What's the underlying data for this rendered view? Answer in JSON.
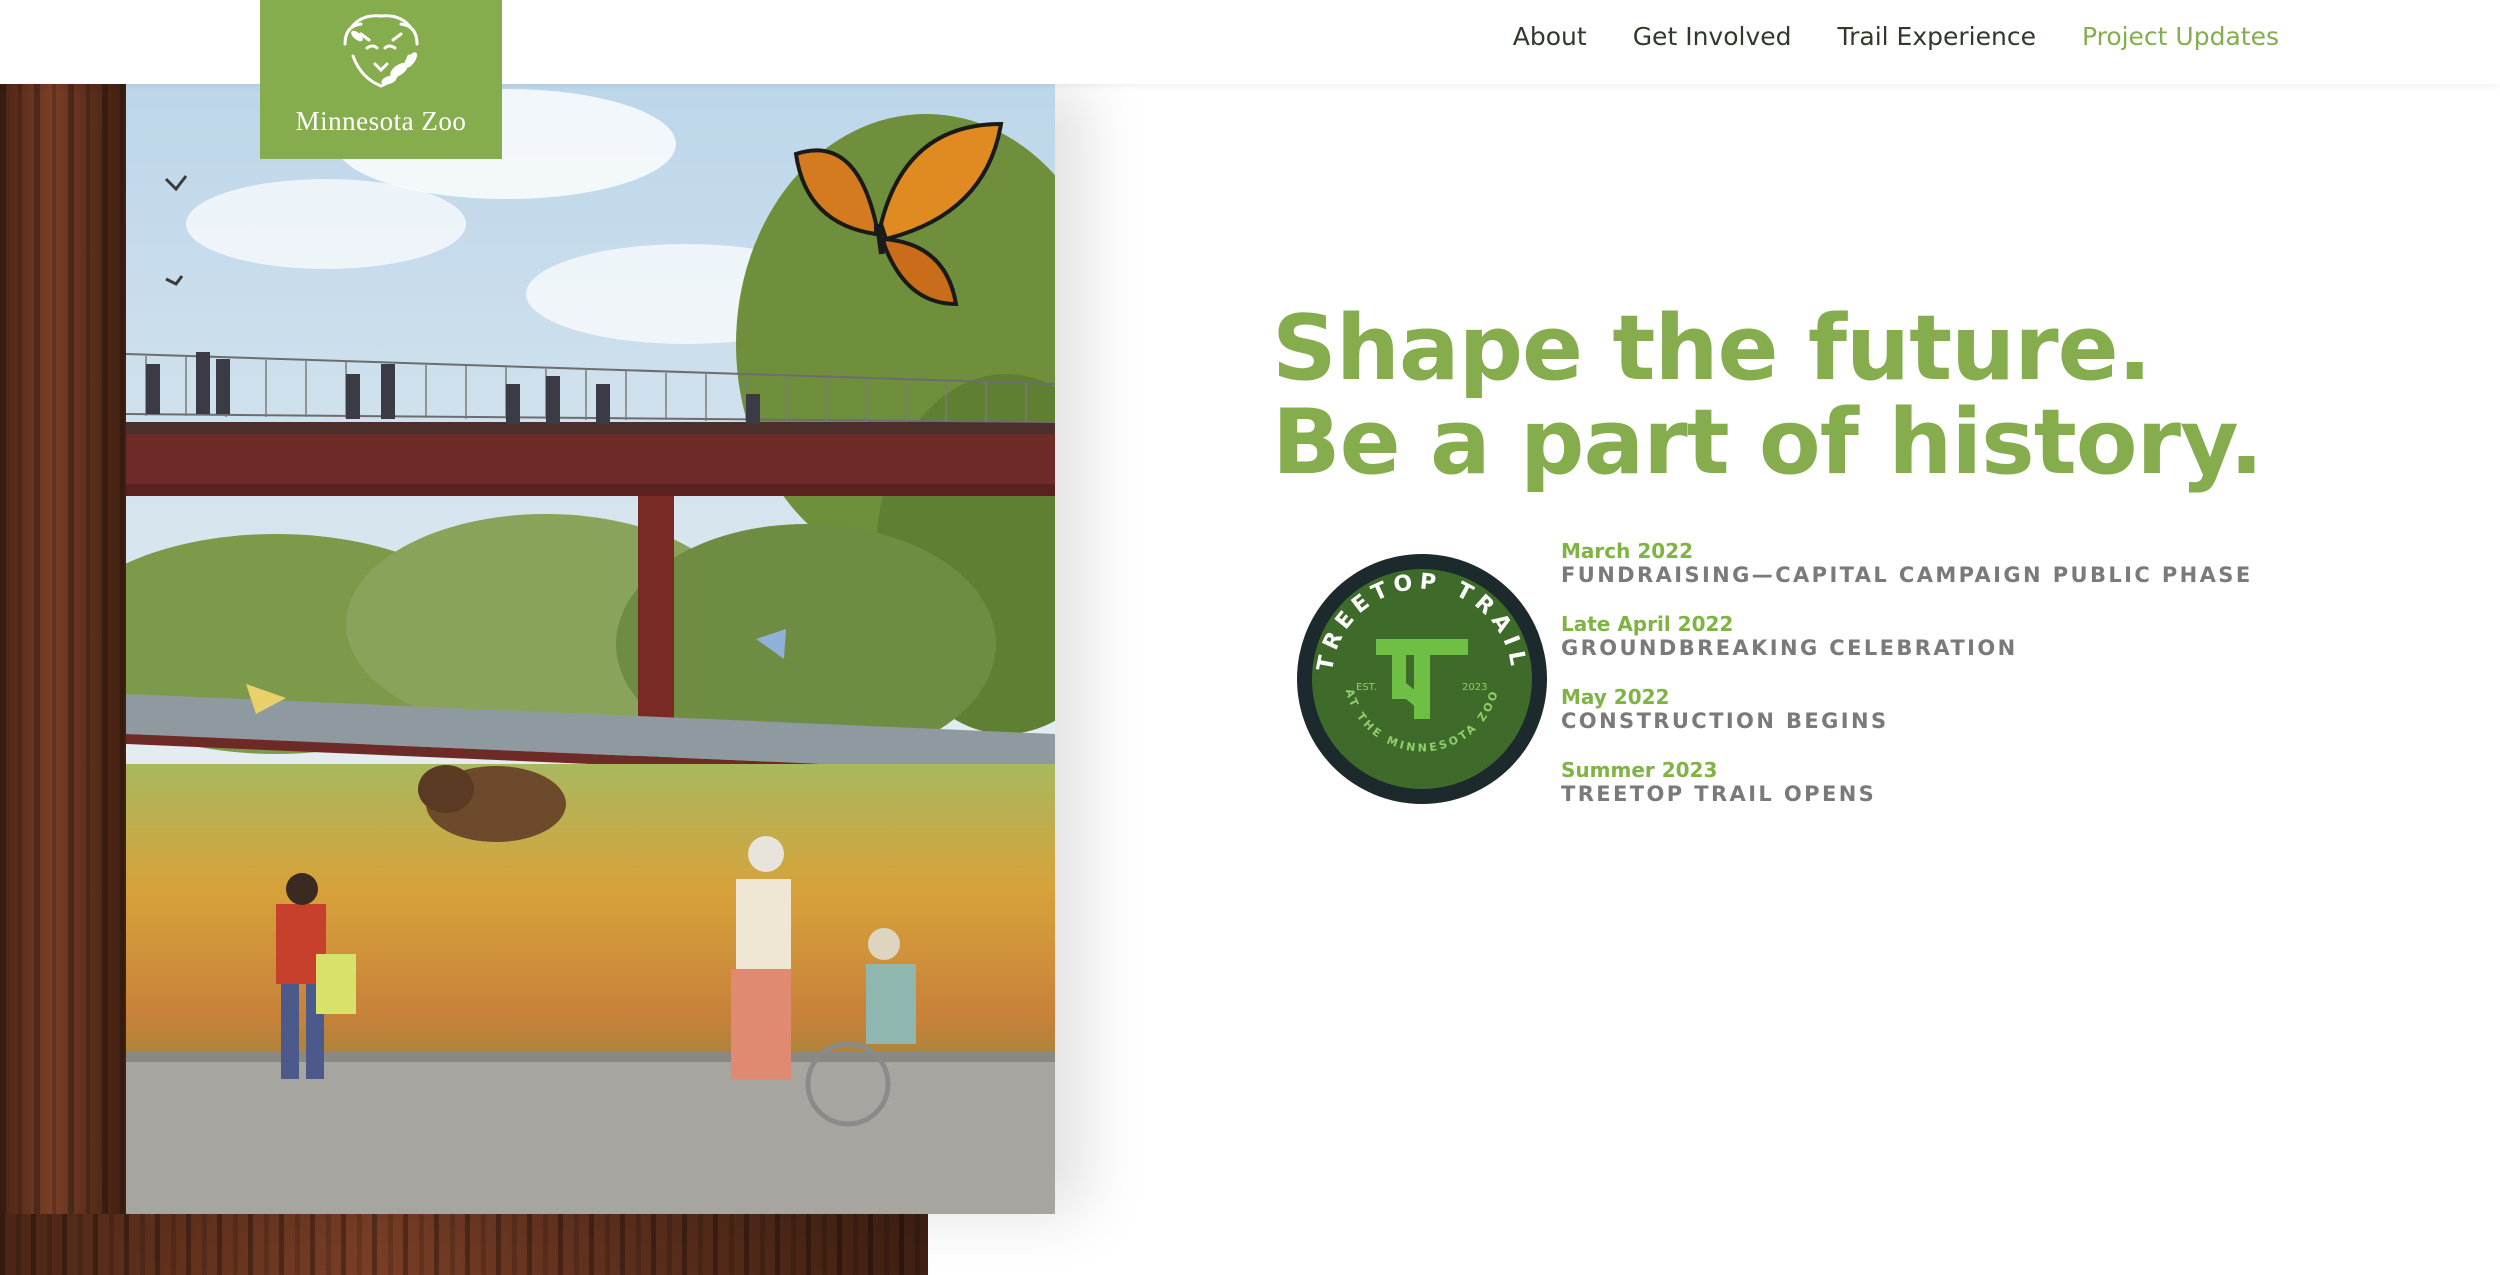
{
  "header": {
    "logo_text": "Minnesota Zoo",
    "nav": [
      {
        "label": "About"
      },
      {
        "label": "Get Involved"
      },
      {
        "label": "Trail Experience"
      },
      {
        "label": "Project Updates",
        "active": true
      }
    ]
  },
  "hero": {
    "headline_line1": "Shape the future.",
    "headline_line2": "Be a part of history."
  },
  "badge": {
    "text_top": "TREETOP TRAIL",
    "text_bottom": "AT THE MINNESOTA ZOO",
    "est_left": "EST.",
    "est_right": "2023"
  },
  "timeline": [
    {
      "date": "March 2022",
      "event": "FUNDRAISING—CAPITAL CAMPAIGN PUBLIC PHASE"
    },
    {
      "date": "Late April 2022",
      "event": "GROUNDBREAKING CELEBRATION"
    },
    {
      "date": "May 2022",
      "event": "CONSTRUCTION BEGINS"
    },
    {
      "date": "Summer 2023",
      "event": "TREETOP TRAIL OPENS"
    }
  ],
  "colors": {
    "brand_green": "#85ad4d",
    "timeline_green": "#7fb343",
    "badge_dark": "#1c2a2e",
    "badge_green": "#3e6b2a",
    "event_gray": "#7a7a7a"
  }
}
